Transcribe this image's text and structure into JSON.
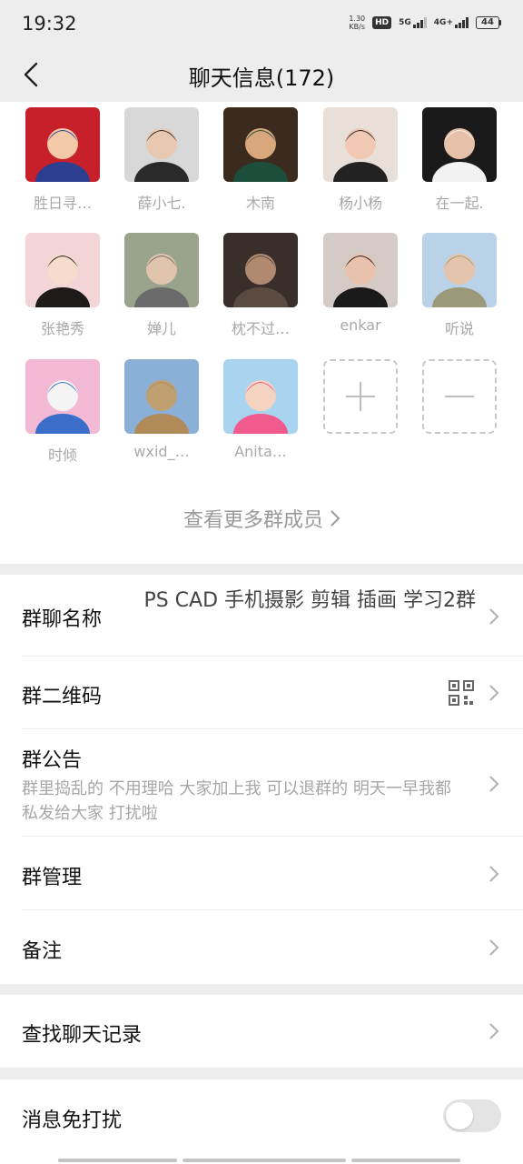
{
  "status_bar": {
    "time": "19:32",
    "net_speed_value": "1.30",
    "net_speed_unit": "KB/s",
    "hd_label": "HD",
    "signal_1_label": "5G",
    "signal_2_label": "4G+",
    "battery": "44"
  },
  "header": {
    "title": "聊天信息(172)"
  },
  "members": [
    {
      "name": "胜日寻…",
      "avatar_icon": "member-avatar"
    },
    {
      "name": "薛小七.",
      "avatar_icon": "member-avatar"
    },
    {
      "name": "木南",
      "avatar_icon": "member-avatar"
    },
    {
      "name": "杨小杨",
      "avatar_icon": "member-avatar"
    },
    {
      "name": "在一起.",
      "avatar_icon": "member-avatar"
    },
    {
      "name": "张艳秀",
      "avatar_icon": "member-avatar"
    },
    {
      "name": "婵儿",
      "avatar_icon": "member-avatar"
    },
    {
      "name": "枕不过…",
      "avatar_icon": "member-avatar"
    },
    {
      "name": "enkar",
      "avatar_icon": "member-avatar"
    },
    {
      "name": "听说",
      "avatar_icon": "member-avatar"
    },
    {
      "name": "时倾",
      "avatar_icon": "member-avatar"
    },
    {
      "name": "wxid_…",
      "avatar_icon": "member-avatar"
    },
    {
      "name": "Anita…",
      "avatar_icon": "member-avatar"
    }
  ],
  "member_actions": {
    "add_icon": "plus-icon",
    "remove_icon": "minus-icon"
  },
  "view_more": "查看更多群成员",
  "settings": {
    "group_name_label": "群聊名称",
    "group_name_value": "PS CAD 手机摄影 剪辑 插画 学习2群",
    "qr_label": "群二维码",
    "notice_label": "群公告",
    "notice_text": "群里捣乱的 不用理哈  大家加上我 可以退群的 明天一早我都私发给大家  打扰啦",
    "manage_label": "群管理",
    "remark_label": "备注",
    "search_label": "查找聊天记录",
    "mute_label": "消息免打扰",
    "mute_enabled": false
  },
  "colors": {
    "background": "#ededed",
    "card": "#ffffff",
    "secondary_text": "#a8a8a8"
  }
}
